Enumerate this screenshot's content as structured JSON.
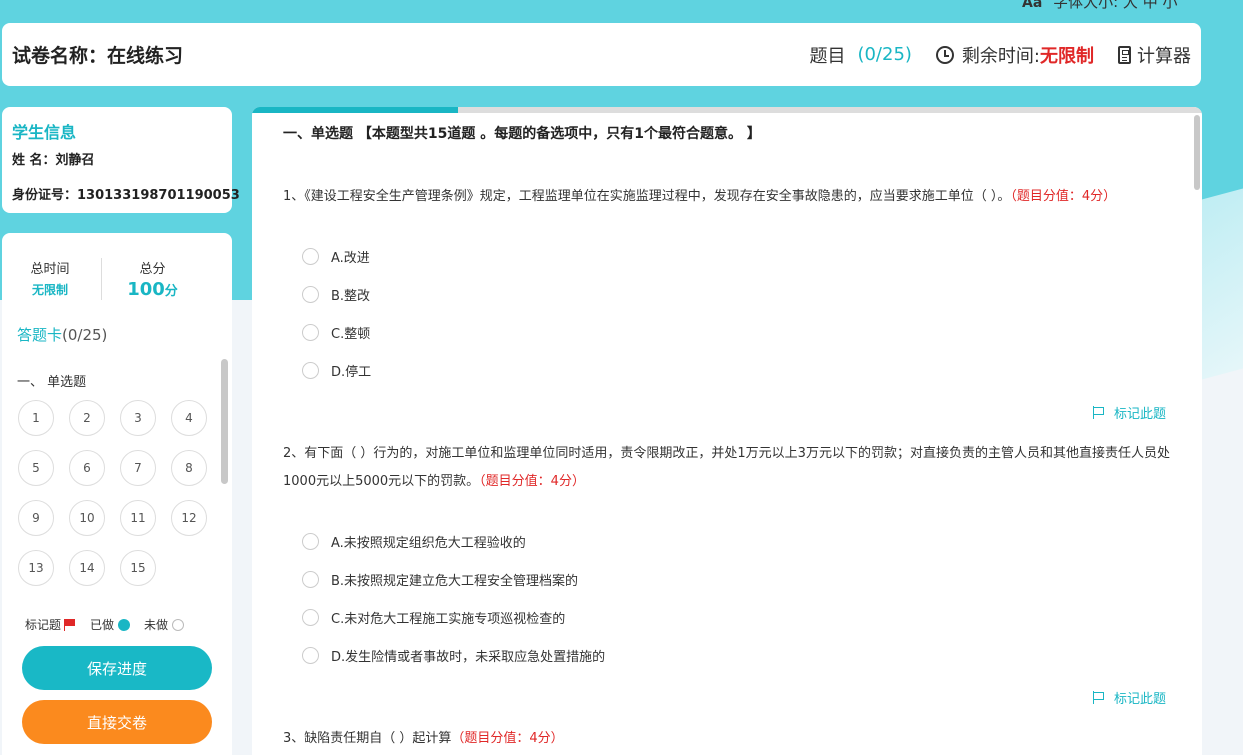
{
  "font_size_bar": {
    "icon": "font-size-icon",
    "label": "字体大小:",
    "options": "大 中 小"
  },
  "header": {
    "paper_title": "试卷名称：在线练习",
    "question_label": "题目",
    "question_count": "(0/25)",
    "time_label": "剩余时间:",
    "time_value": "无限制",
    "calculator_label": "计算器"
  },
  "student": {
    "title": "学生信息",
    "name_row": "姓  名：刘静召",
    "id_row": "身份证号：130133198701190053"
  },
  "stats": {
    "total_time_label": "总时间",
    "total_time_value": "无限制",
    "total_score_label": "总分",
    "total_score_value": "100",
    "total_score_unit": "分"
  },
  "answer_card": {
    "title": "答题卡",
    "count": "(0/25)",
    "section": "一、 单选题",
    "numbers": [
      "1",
      "2",
      "3",
      "4",
      "5",
      "6",
      "7",
      "8",
      "9",
      "10",
      "11",
      "12",
      "13",
      "14",
      "15"
    ]
  },
  "legend": {
    "marked": "标记题",
    "done": "已做",
    "todo": "未做"
  },
  "buttons": {
    "save": "保存进度",
    "submit": "直接交卷"
  },
  "progress": {
    "fraction": 0.217
  },
  "main": {
    "section_heading": "一、单选题 【本题型共15道题 。每题的备选项中，只有1个最符合题意。 】",
    "mark_label": "标记此题",
    "questions": [
      {
        "text": "1、《建设工程安全生产管理条例》规定，工程监理单位在实施监理过程中，发现存在安全事故隐患的，应当要求施工单位（   ）。",
        "score": "（题目分值：4分）",
        "options": [
          "A.改进",
          "B.整改",
          "C.整顿",
          "D.停工"
        ]
      },
      {
        "text": "2、有下面（   ）行为的，对施工单位和监理单位同时适用，责令限期改正，并处1万元以上3万元以下的罚款；对直接负责的主管人员和其他直接责任人员处1000元以上5000元以下的罚款。",
        "score": "（题目分值：4分）",
        "options": [
          "A.未按照规定组织危大工程验收的",
          "B.未按照规定建立危大工程安全管理档案的",
          "C.未对危大工程施工实施专项巡视检查的",
          "D.发生险情或者事故时，未采取应急处置措施的"
        ]
      },
      {
        "text": "3、缺陷责任期自（   ）起计算",
        "score": "（题目分值：4分）"
      }
    ]
  }
}
